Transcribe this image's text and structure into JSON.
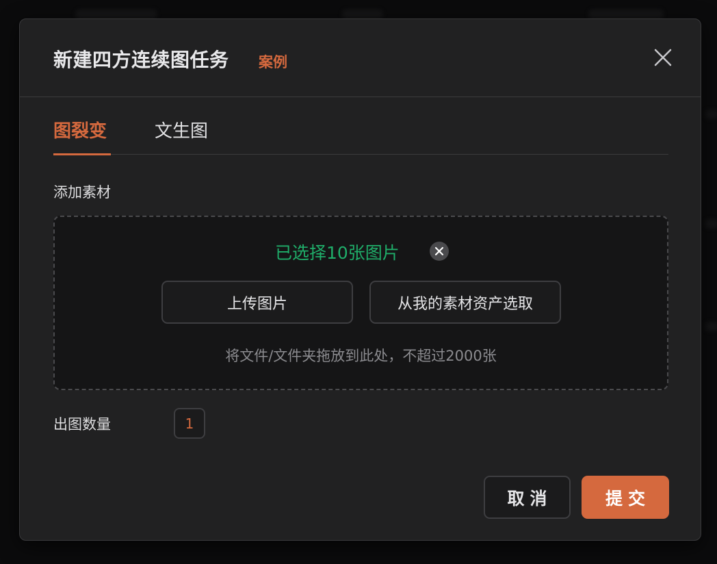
{
  "dialog": {
    "title": "新建四方连续图任务",
    "title_tag": "案例",
    "close_icon": "close-icon"
  },
  "tabs": [
    {
      "label": "图裂变",
      "active": true
    },
    {
      "label": "文生图",
      "active": false
    }
  ],
  "materials": {
    "label": "添加素材",
    "selected_text": "已选择10张图片",
    "clear_icon": "clear-icon",
    "upload_button": "上传图片",
    "library_button": "从我的素材资产选取",
    "hint": "将文件/文件夹拖放到此处，不超过2000张"
  },
  "quantity": {
    "label": "出图数量",
    "value": "1"
  },
  "footer": {
    "cancel_label": "取消",
    "submit_label": "提交"
  },
  "colors": {
    "accent": "#d5693e",
    "success": "#1fae6a",
    "dialog_bg": "#212122"
  }
}
